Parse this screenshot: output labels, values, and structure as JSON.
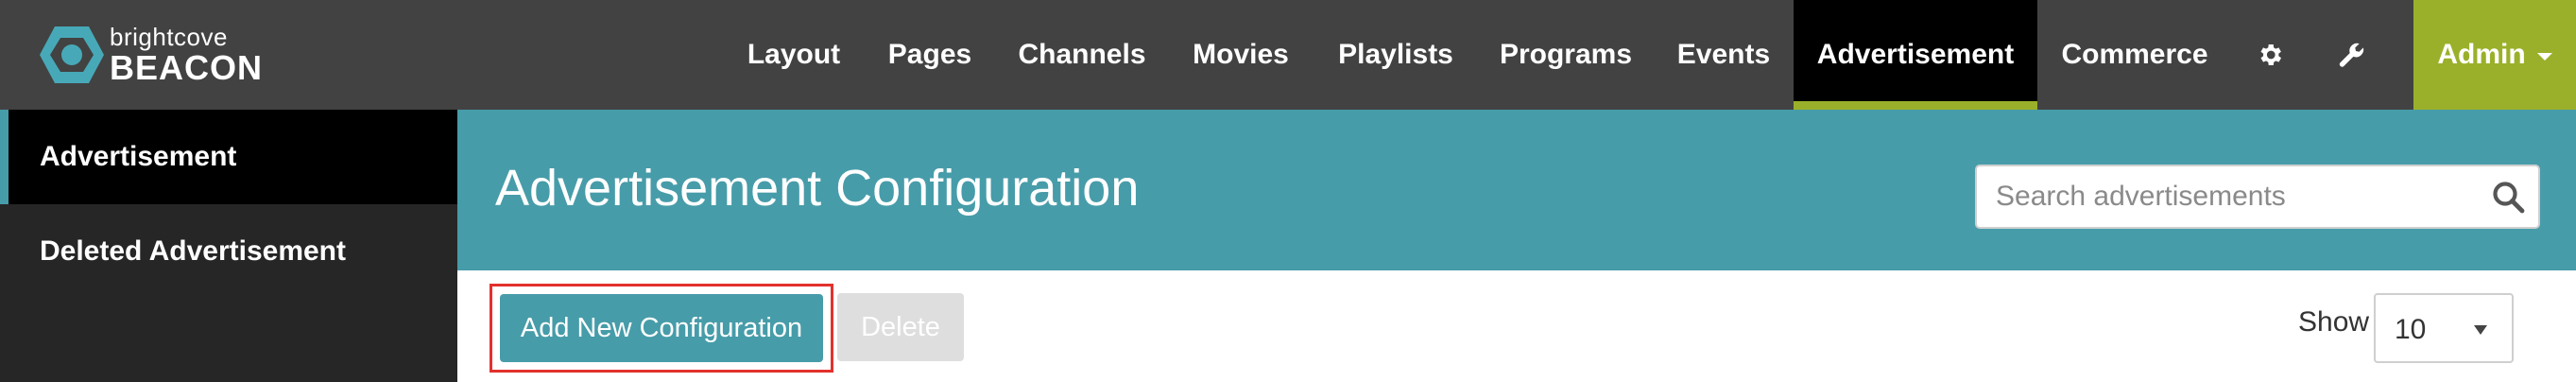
{
  "brand": {
    "small": "brightcove",
    "big": "BEACON"
  },
  "nav": {
    "items": [
      "Layout",
      "Pages",
      "Channels",
      "Movies",
      "Playlists",
      "Programs",
      "Events",
      "Advertisement",
      "Commerce"
    ],
    "active": "Advertisement",
    "settings_icon": "gear-icon",
    "tools_icon": "wrench-icon",
    "admin_label": "Admin"
  },
  "sidebar": {
    "items": [
      {
        "label": "Advertisement",
        "active": true
      },
      {
        "label": "Deleted Advertisement",
        "active": false
      }
    ]
  },
  "header": {
    "title": "Advertisement Configuration",
    "search_placeholder": "Search advertisements"
  },
  "actions": {
    "add_label": "Add New Configuration",
    "delete_label": "Delete",
    "show_label": "Show",
    "show_value": "10"
  },
  "colors": {
    "topbar": "#424242",
    "accent_teal": "#479ca9",
    "accent_green": "#9bb02a",
    "highlight_red": "#e3312d"
  }
}
